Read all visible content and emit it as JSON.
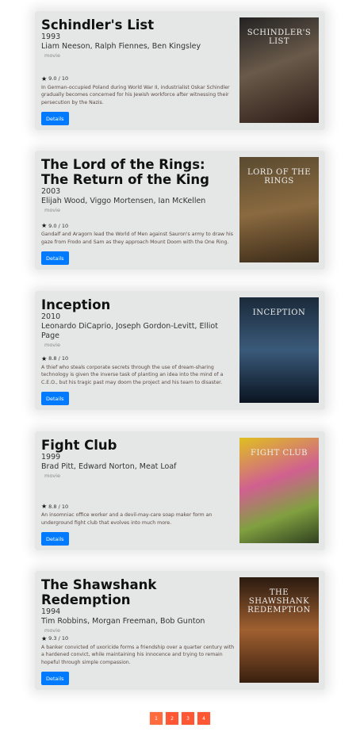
{
  "movies": [
    {
      "title": "Schindler's List",
      "year": "1993",
      "cast": "Liam Neeson, Ralph Fiennes, Ben Kingsley",
      "kind": "movie",
      "rating": "9.0 / 10",
      "description": "In German-occupied Poland during World War II, industrialist Oskar Schindler gradually becomes concerned for his Jewish workforce after witnessing their persecution by the Nazis.",
      "button": "Details",
      "poster_text": "SCHINDLER'S LIST"
    },
    {
      "title": "The Lord of the Rings: The Return of the King",
      "year": "2003",
      "cast": "Elijah Wood, Viggo Mortensen, Ian McKellen",
      "kind": "movie",
      "rating": "9.0 / 10",
      "description": "Gandalf and Aragorn lead the World of Men against Sauron's army to draw his gaze from Frodo and Sam as they approach Mount Doom with the One Ring.",
      "button": "Details",
      "poster_text": "LORD OF THE RINGS"
    },
    {
      "title": "Inception",
      "year": "2010",
      "cast": "Leonardo DiCaprio, Joseph Gordon-Levitt, Elliot Page",
      "kind": "movie",
      "rating": "8.8 / 10",
      "description": "A thief who steals corporate secrets through the use of dream-sharing technology is given the inverse task of planting an idea into the mind of a C.E.O., but his tragic past may doom the project and his team to disaster.",
      "button": "Details",
      "poster_text": "INCEPTION"
    },
    {
      "title": "Fight Club",
      "year": "1999",
      "cast": "Brad Pitt, Edward Norton, Meat Loaf",
      "kind": "movie",
      "rating": "8.8 / 10",
      "description": "An insomniac office worker and a devil-may-care soap maker form an underground fight club that evolves into much more.",
      "button": "Details",
      "poster_text": "FIGHT CLUB"
    },
    {
      "title": "The Shawshank Redemption",
      "year": "1994",
      "cast": "Tim Robbins, Morgan Freeman, Bob Gunton",
      "kind": "movie",
      "rating": "9.3 / 10",
      "description": "A banker convicted of uxoricide forms a friendship over a quarter century with a hardened convict, while maintaining his innocence and trying to remain hopeful through simple compassion.",
      "button": "Details",
      "poster_text": "THE SHAWSHANK REDEMPTION"
    }
  ],
  "pagination": {
    "pages": [
      "1",
      "2",
      "3",
      "4"
    ],
    "current": "1"
  },
  "colors": {
    "button": "#007bff",
    "pager": "#ff5733",
    "card": "#e5e6e6"
  }
}
